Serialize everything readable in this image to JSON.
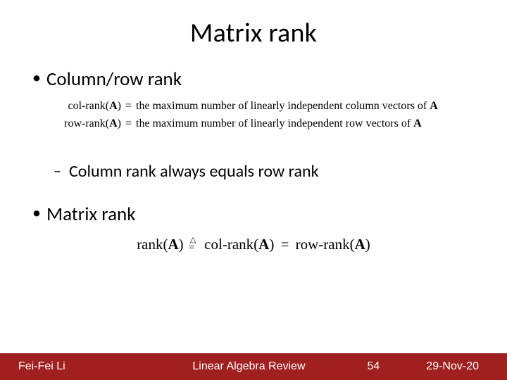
{
  "title": "Matrix rank",
  "bullets": {
    "b1": "Column/row rank",
    "b2": "Column rank always equals row rank",
    "b3": "Matrix rank"
  },
  "definitions": {
    "col_lhs": "col-rank(",
    "row_lhs": "row-rank(",
    "A": "A",
    "paren_close": ")",
    "eq": "=",
    "col_rhs": "the maximum number of linearly independent column vectors of ",
    "row_rhs": "the maximum number of linearly independent row vectors of "
  },
  "rank_eq": {
    "rank": "rank(",
    "A": "A",
    "paren_close": ")",
    "col": "col-rank(",
    "row": "row-rank(",
    "eq": "="
  },
  "footer": {
    "author": "Fei-Fei Li",
    "course": "Linear Algebra Review",
    "page": "54",
    "date": "29-Nov-20"
  }
}
